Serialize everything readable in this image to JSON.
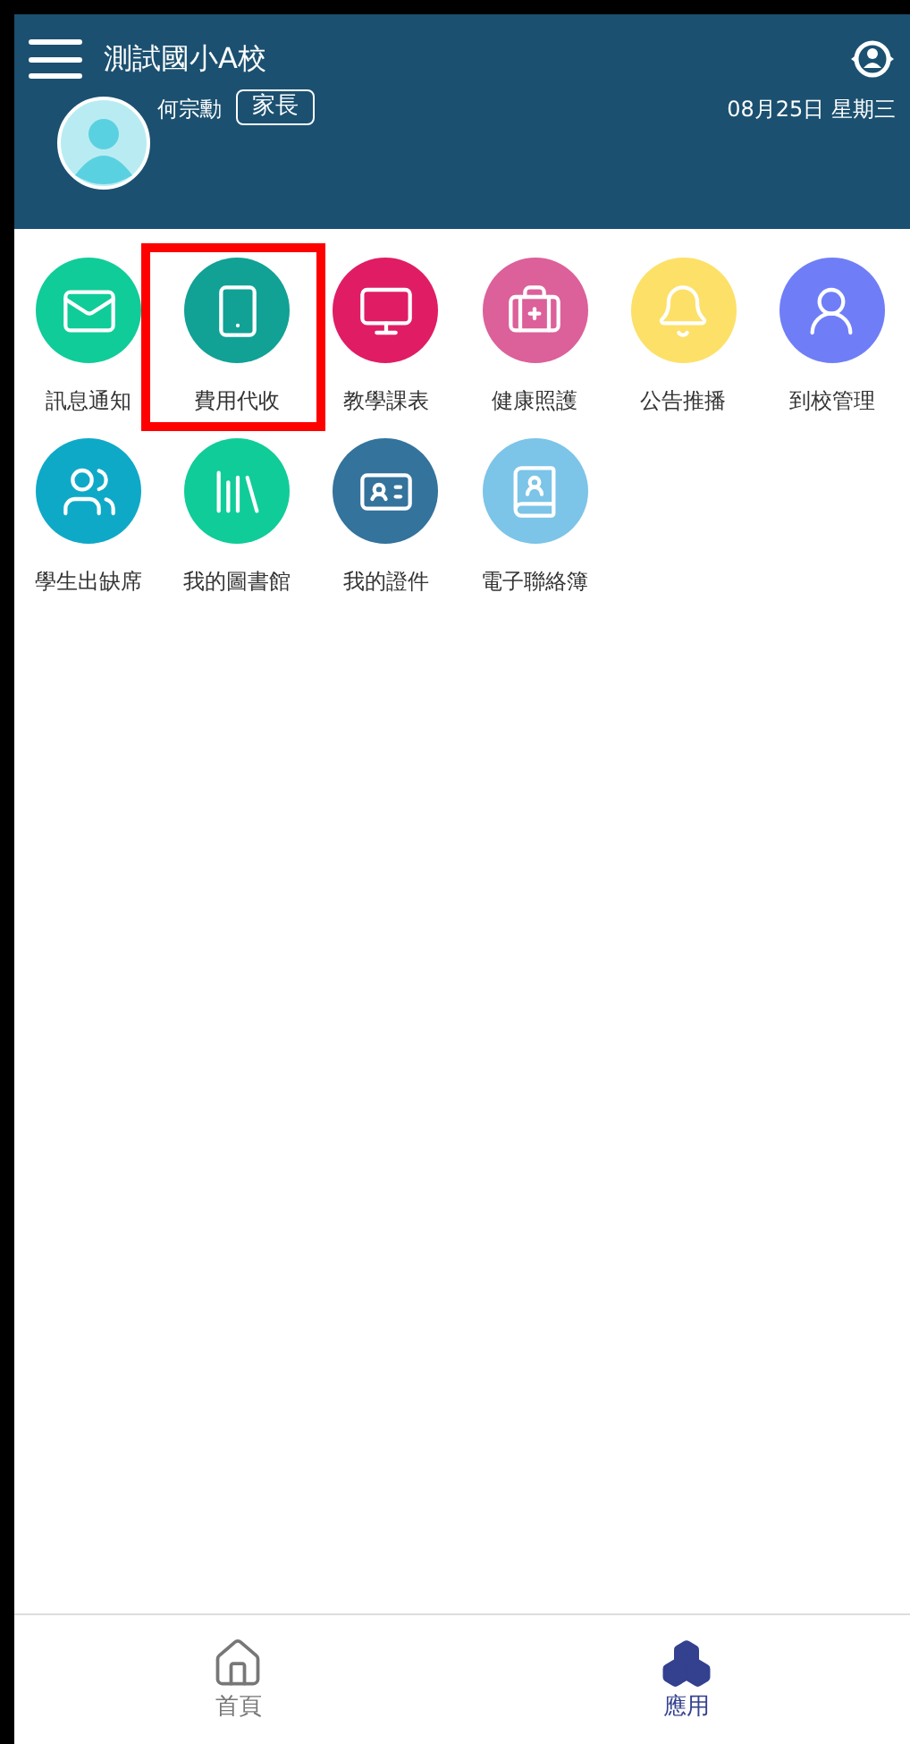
{
  "header": {
    "title": "測試國小A校",
    "user_name": "何宗勳",
    "role": "家長",
    "date": "08月25日 星期三"
  },
  "apps": [
    {
      "label": "訊息通知",
      "color": "#10cc98",
      "highlighted": false
    },
    {
      "label": "費用代收",
      "color": "#11a195",
      "highlighted": true
    },
    {
      "label": "教學課表",
      "color": "#e01c64",
      "highlighted": false
    },
    {
      "label": "健康照護",
      "color": "#dc609a",
      "highlighted": false
    },
    {
      "label": "公告推播",
      "color": "#fde068",
      "highlighted": false
    },
    {
      "label": "到校管理",
      "color": "#6f7ef7",
      "highlighted": false
    },
    {
      "label": "學生出缺席",
      "color": "#0fa9c8",
      "highlighted": false
    },
    {
      "label": "我的圖書館",
      "color": "#10cc98",
      "highlighted": false
    },
    {
      "label": "我的證件",
      "color": "#33739c",
      "highlighted": false
    },
    {
      "label": "電子聯絡簿",
      "color": "#7cc4e8",
      "highlighted": false
    }
  ],
  "bottom_nav": [
    {
      "label": "首頁",
      "selected": false
    },
    {
      "label": "應用",
      "selected": true
    }
  ]
}
